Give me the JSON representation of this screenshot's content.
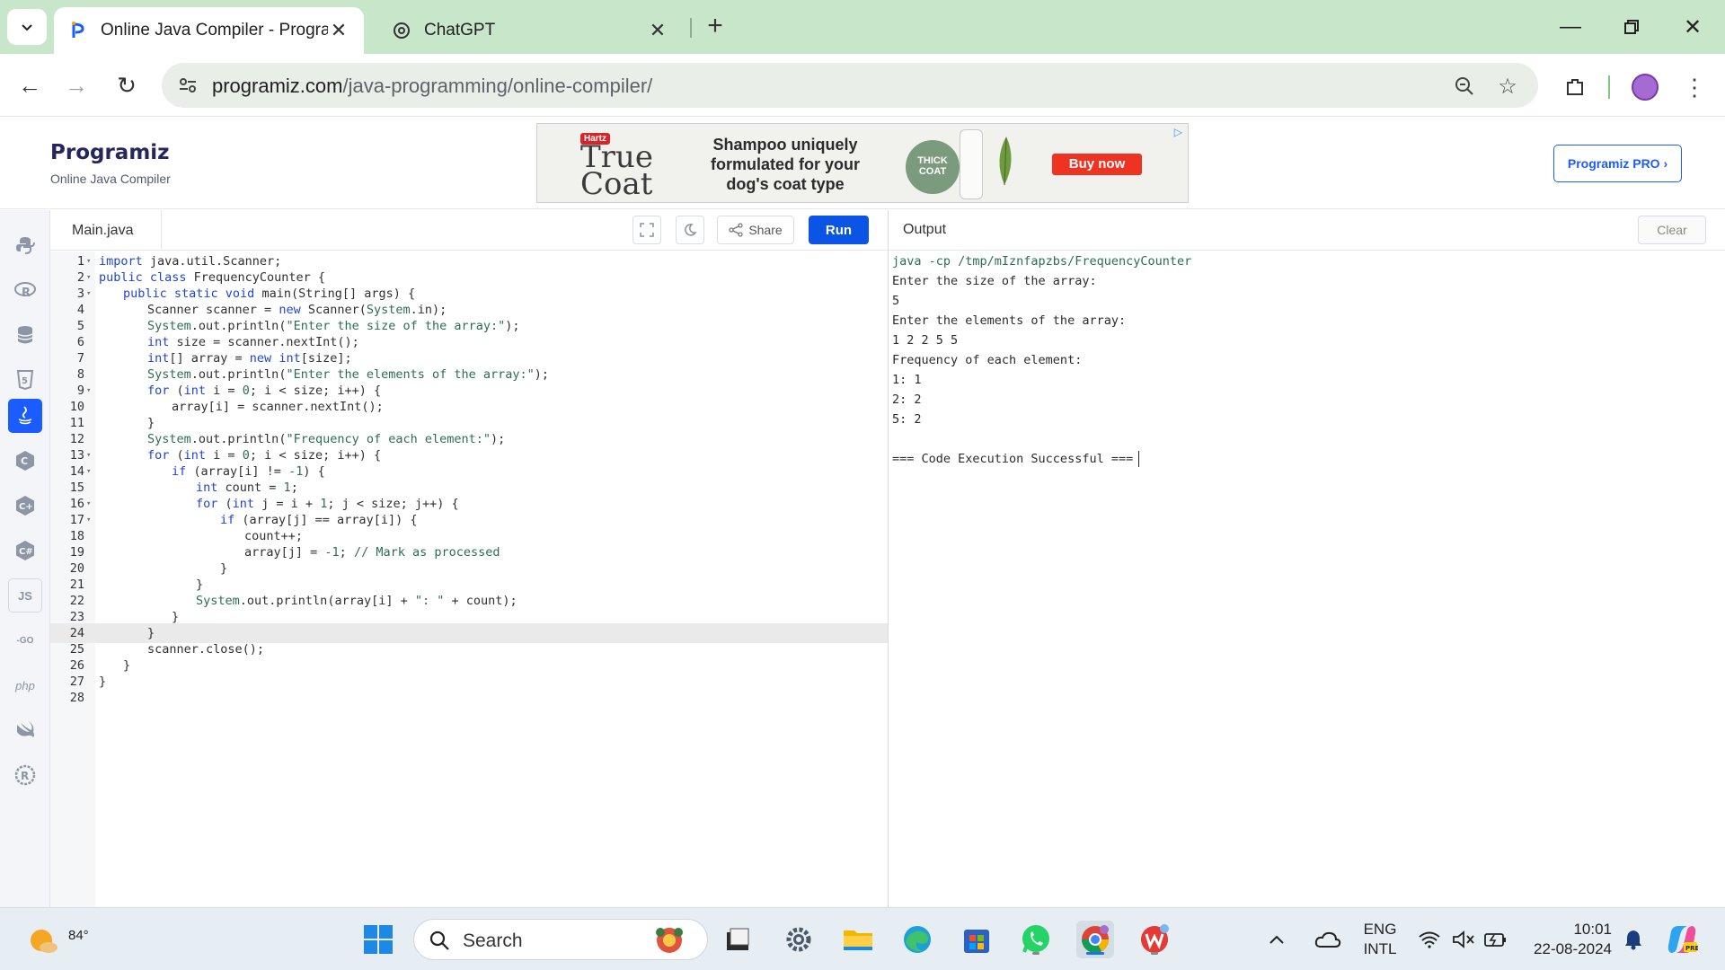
{
  "browser": {
    "tabs": [
      {
        "title": "Online Java Compiler - Program",
        "active": true
      },
      {
        "title": "ChatGPT",
        "active": false
      }
    ],
    "url_host": "programiz.com",
    "url_path": "/java-programming/online-compiler/"
  },
  "header": {
    "logo": "Programiz",
    "subtitle": "Online Java Compiler",
    "pro_button": "Programiz PRO ›",
    "ad": {
      "badge": "Hartz",
      "brand_line1": "True",
      "brand_line2": "Coat",
      "headline": "Shampoo uniquely formulated for your dog's coat type",
      "product_label": "THICK COAT",
      "cta": "Buy now"
    }
  },
  "sidebar": {
    "languages": [
      {
        "name": "python",
        "label": "",
        "active": false
      },
      {
        "name": "r",
        "label": "R",
        "active": false
      },
      {
        "name": "sql",
        "label": "",
        "active": false
      },
      {
        "name": "html",
        "label": "5",
        "active": false
      },
      {
        "name": "java",
        "label": "",
        "active": true
      },
      {
        "name": "c",
        "label": "C",
        "active": false
      },
      {
        "name": "cpp",
        "label": "C",
        "active": false
      },
      {
        "name": "csharp",
        "label": "C",
        "active": false
      },
      {
        "name": "javascript",
        "label": "JS",
        "active": false
      },
      {
        "name": "go",
        "label": "-GO",
        "active": false
      },
      {
        "name": "php",
        "label": "php",
        "active": false
      },
      {
        "name": "swift",
        "label": "",
        "active": false
      },
      {
        "name": "rust",
        "label": "R",
        "active": false
      }
    ]
  },
  "editor": {
    "filename": "Main.java",
    "share_label": "Share",
    "run_label": "Run",
    "highlighted_line": 24
  },
  "output": {
    "title": "Output",
    "clear_label": "Clear",
    "lines": [
      "java -cp /tmp/mIznfapzbs/FrequencyCounter",
      "Enter the size of the array:",
      "5",
      "Enter the elements of the array:",
      "1 2 2 5 5",
      "Frequency of each element:",
      "1: 1",
      "2: 2",
      "5: 2",
      "",
      "=== Code Execution Successful ==="
    ]
  },
  "taskbar": {
    "temperature": "84°",
    "search_placeholder": "Search",
    "language_line1": "ENG",
    "language_line2": "INTL",
    "time": "10:01",
    "date": "22-08-2024"
  },
  "colors": {
    "accent": "#1a5cff",
    "run_button": "#0b55e6",
    "tabstrip": "#c8e6c9",
    "keyword": "#1f44d6",
    "string": "#2a6e55"
  }
}
